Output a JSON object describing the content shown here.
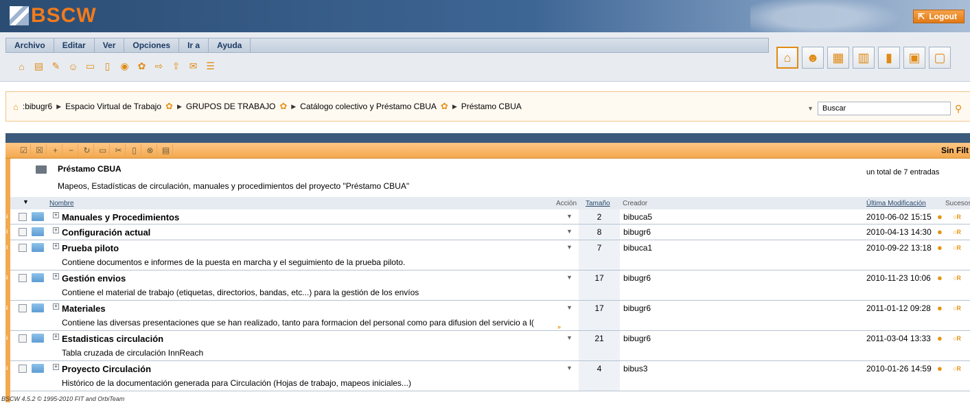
{
  "banner": {
    "logo": "BSCW",
    "logout": "Logout"
  },
  "menu": [
    "Archivo",
    "Editar",
    "Ver",
    "Opciones",
    "Ir a",
    "Ayuda"
  ],
  "toolbar_icons": [
    "open-folder-icon",
    "note-icon",
    "pencil-icon",
    "add-user-icon",
    "add-folder-icon",
    "add-document-icon",
    "add-url-icon",
    "add-group-icon",
    "export-icon",
    "upload-icon",
    "mail-icon",
    "notes-icon"
  ],
  "quick_icons": [
    "home-icon",
    "members-icon",
    "clipboard-icon",
    "trash-icon",
    "bookmark-icon",
    "calendar-icon",
    "tasks-icon"
  ],
  "breadcrumb": {
    "items": [
      ":bibugr6",
      "Espacio Virtual de Trabajo",
      "GRUPOS DE TRABAJO",
      "Catálogo colectivo y Préstamo CBUA",
      "Préstamo CBUA"
    ]
  },
  "search": {
    "placeholder": "Buscar",
    "value": "Buscar"
  },
  "actions": {
    "filter_label": "Sin Filt"
  },
  "folder": {
    "title": "Préstamo CBUA",
    "description": "Mapeos, Estadísticas de circulación, manuales y procedimientos del proyecto \"Préstamo CBUA\"",
    "total": "un total de 7 entradas"
  },
  "columns": {
    "name": "Nombre",
    "action": "Acción",
    "size": "Tamaño",
    "creator": "Creador",
    "modified": "Última Modificación",
    "events": "Sucesos"
  },
  "rows": [
    {
      "name": "Manuales y Procedimientos",
      "size": "2",
      "creator": "bibuca5",
      "date": "2010-06-02 15:15",
      "desc": ""
    },
    {
      "name": "Configuración actual",
      "size": "8",
      "creator": "bibugr6",
      "date": "2010-04-13 14:30",
      "desc": ""
    },
    {
      "name": "Prueba piloto",
      "size": "7",
      "creator": "bibuca1",
      "date": "2010-09-22 13:18",
      "desc": "Contiene documentos e informes de la puesta en marcha y el seguimiento de la prueba piloto."
    },
    {
      "name": "Gestión envios",
      "size": "17",
      "creator": "bibugr6",
      "date": "2010-11-23 10:06",
      "desc": "Contiene el material de trabajo (etiquetas, directorios, bandas, etc...) para la gestión de los envíos"
    },
    {
      "name": "Materiales",
      "size": "17",
      "creator": "bibugr6",
      "date": "2011-01-12 09:28",
      "desc": "Contiene las diversas presentaciones que se han realizado, tanto para formacion del personal como para difusion del servicio a l("
    },
    {
      "name": "Estadisticas circulación",
      "size": "21",
      "creator": "bibugr6",
      "date": "2011-03-04 13:33",
      "desc": "Tabla cruzada de circulación InnReach"
    },
    {
      "name": "Proyecto Circulación",
      "size": "4",
      "creator": "bibus3",
      "date": "2010-01-26 14:59",
      "desc": "Histórico de la documentación generada para Circulación (Hojas de trabajo, mapeos iniciales...)"
    }
  ],
  "footer": "BSCW 4.5.2 © 1995-2010 FIT and OrbiTeam"
}
